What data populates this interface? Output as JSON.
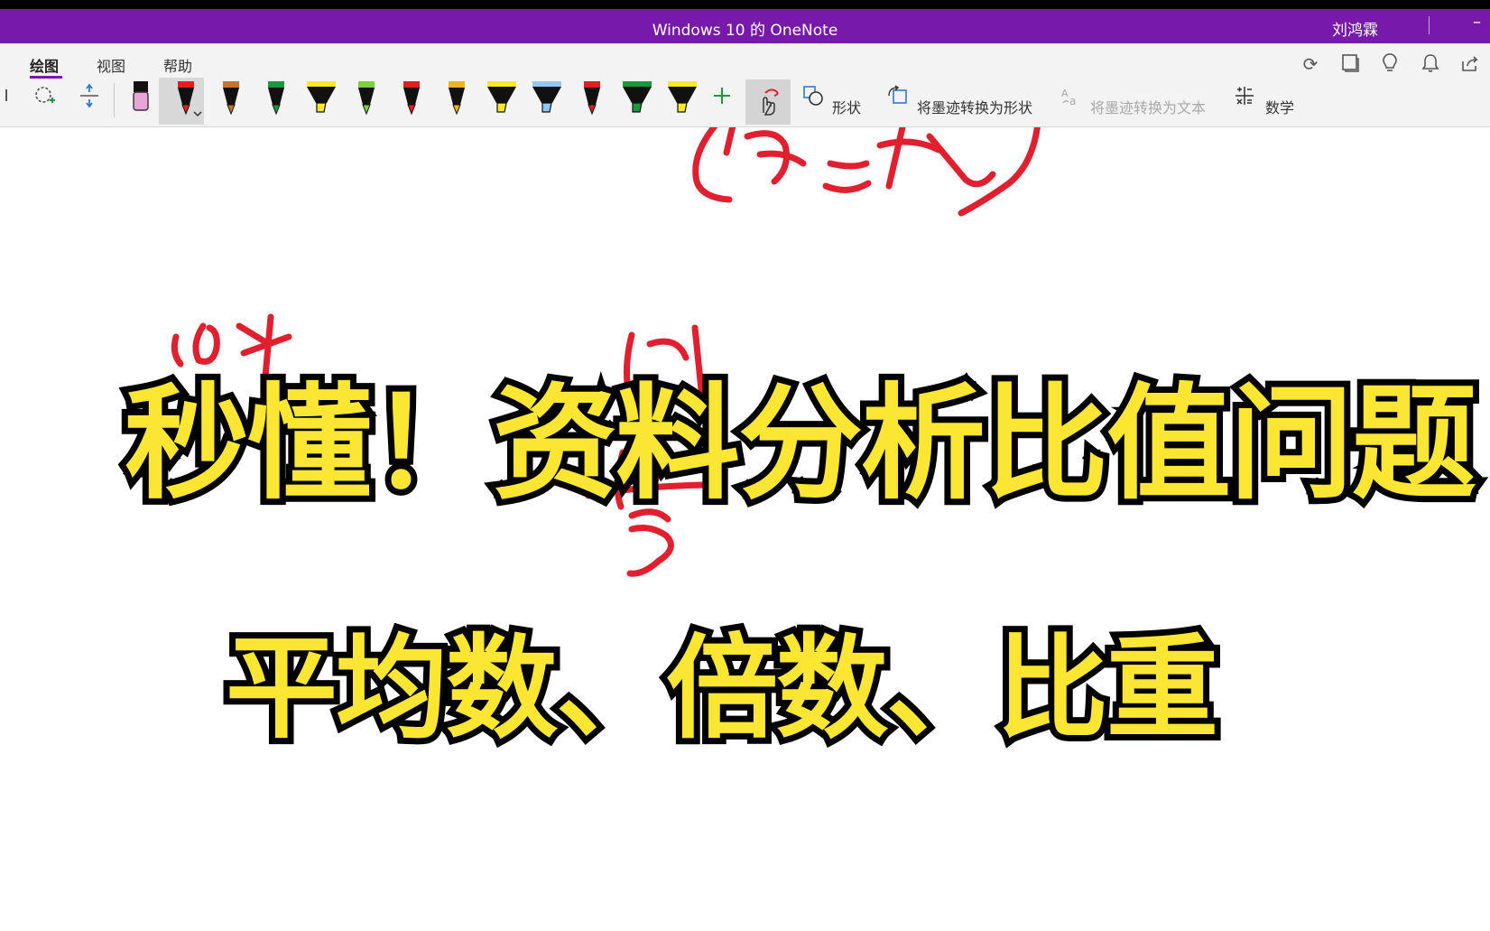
{
  "window": {
    "title": "Windows 10 的 OneNote",
    "user": "刘鸿霖",
    "minimize": "–"
  },
  "tabs": [
    {
      "label": "绘图",
      "active": true
    },
    {
      "label": "视图",
      "active": false
    },
    {
      "label": "帮助",
      "active": false
    }
  ],
  "toolbar": {
    "shapes_label": "形状",
    "ink_to_shape_label": "将墨迹转换为形状",
    "ink_to_text_label": "将墨迹转换为文本",
    "math_label": "数学"
  },
  "pens": [
    {
      "color": "#e8a6d8",
      "kind": "eraser"
    },
    {
      "color": "#e02020",
      "kind": "pen",
      "selected": true
    },
    {
      "color": "#c8742c",
      "kind": "pen"
    },
    {
      "color": "#1a9a3a",
      "kind": "pen"
    },
    {
      "color": "#f7e92a",
      "kind": "highlighter"
    },
    {
      "color": "#7ad13a",
      "kind": "pen"
    },
    {
      "color": "#e02020",
      "kind": "pen"
    },
    {
      "color": "#f2b41c",
      "kind": "pen"
    },
    {
      "color": "#f7e92a",
      "kind": "highlighter"
    },
    {
      "color": "#8fc8f0",
      "kind": "highlighter"
    },
    {
      "color": "#e02020",
      "kind": "pen"
    },
    {
      "color": "#1a9a3a",
      "kind": "highlighter"
    },
    {
      "color": "#f7e92a",
      "kind": "highlighter"
    }
  ],
  "headline": {
    "line1": "秒懂！资料分析比值问题",
    "line2": "平均数、倍数、比重"
  },
  "colors": {
    "brand": "#7719aa",
    "headline_fill": "#fbe733",
    "ink": "#e0202e"
  }
}
